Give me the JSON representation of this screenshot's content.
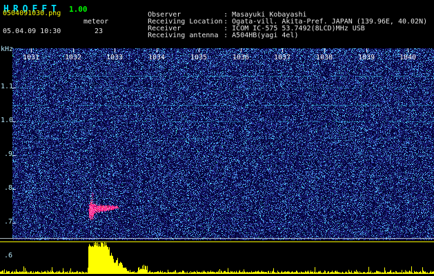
{
  "app": {
    "title_letters": [
      "H",
      "R",
      "O",
      "F",
      "F",
      "T"
    ],
    "version": "1.00"
  },
  "header": {
    "filename": "0504091030.png",
    "mode": "meteor",
    "datetime": "05.04.09 10:30",
    "count": "23",
    "colon": ":",
    "info": [
      {
        "label": "Observer",
        "value": "Masayuki Kobayashi"
      },
      {
        "label": "Receiving Location",
        "value": "Ogata-vill. Akita-Pref. JAPAN (139.96E, 40.02N)"
      },
      {
        "label": "Receiver",
        "value": "ICOM IC-575 53.7492(8LCD)MHz USB"
      },
      {
        "label": "Receiving antenna",
        "value": "A504HB(yagi 4el)"
      }
    ]
  },
  "chart_data": {
    "type": "heatmap",
    "subtype": "radio meteor echo spectrogram with amplitude strip (HROFFT output)",
    "x_axis": {
      "unit": "time HHMM",
      "tick_labels": [
        "1031",
        "1032",
        "1033",
        "1034",
        "1035",
        "1036",
        "1037",
        "1038",
        "1039",
        "1040"
      ],
      "range": [
        "1030",
        "1040"
      ]
    },
    "y_axis": {
      "label": "kHz",
      "tick_labels": [
        "1.1",
        "1.0",
        ".9",
        ".8",
        ".7",
        ".6"
      ],
      "range": [
        0.6,
        1.2
      ]
    },
    "events": [
      {
        "type": "meteor-echo",
        "time": "1032",
        "frequency_khz": 0.75,
        "color": "#ff2d9b",
        "description": "strong pink echo blob just after the 1032 minute mark"
      }
    ],
    "amplitude_strip": {
      "description": "signal level vs time along bottom",
      "color": "#ffff00",
      "events": [
        {
          "time": "1032",
          "level": "saturated broadband burst"
        }
      ]
    },
    "colors": {
      "background": "#000041",
      "noise": "#2a3cc0",
      "bright_speckle": "#39d5ff",
      "echo": "#ff2d9b",
      "amplitude": "#ffff00"
    },
    "grid": "horizontal interference lines at upper frequencies",
    "legend": "none"
  }
}
